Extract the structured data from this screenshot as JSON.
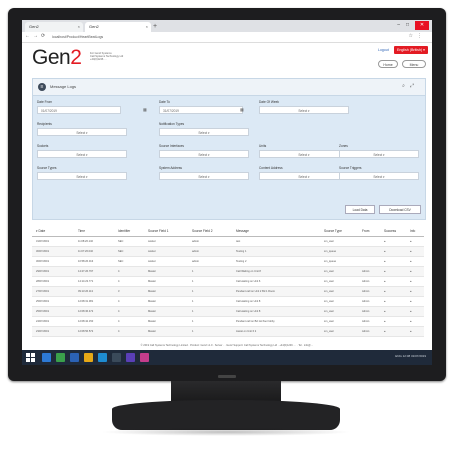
{
  "browser": {
    "tabs": [
      "Gen2",
      "Gen2"
    ],
    "url": "localhost/Product/HeartBeatLogs",
    "window_controls": [
      "–",
      "□",
      "✕"
    ]
  },
  "app": {
    "logo_main": "Gen",
    "logo_accent": "2",
    "tagline_lines": [
      "For Gen2 Systems",
      "Call Systems Technology Ltd",
      "+44(0)1246 …"
    ],
    "login_label": "Logout",
    "language_button": "English (British) ▾",
    "buttons": [
      "Home",
      "Menu"
    ]
  },
  "panel": {
    "title": "Message Logs",
    "filters": [
      {
        "label": "Date From",
        "value": "01/07/2019"
      },
      {
        "label": "Date To",
        "value": "31/07/2019"
      },
      {
        "label": "Date Of Week",
        "value": "Select ▾"
      },
      {
        "label": "Recipients",
        "value": "Select ▾"
      },
      {
        "label": "Notification Types",
        "value": "Select ▾"
      },
      {
        "label": "Sockets",
        "value": "Select ▾"
      },
      {
        "label": "Source Interfaces",
        "value": "Select ▾"
      },
      {
        "label": "Units",
        "value": "Select ▾"
      },
      {
        "label": "Zones",
        "value": "Select ▾"
      },
      {
        "label": "Source Types",
        "value": "Select ▾"
      },
      {
        "label": "System Address",
        "value": "Select ▾"
      },
      {
        "label": "Content Address",
        "value": "Select ▾"
      },
      {
        "label": "Source Triggers",
        "value": "Select ▾"
      }
    ],
    "buttons": [
      "Load Data",
      "Download CSV"
    ]
  },
  "table": {
    "columns": [
      "▾ Date",
      "Time",
      "Identifier",
      "Source Field 1",
      "Source Field 2",
      "Message",
      "Source Type",
      "From",
      "Success",
      "Info"
    ],
    "rows": [
      [
        "31/07/2019",
        "11:08:26.132",
        "SEC",
        "worker",
        "admin",
        "test",
        "sm_user",
        "",
        "●",
        "●"
      ],
      [
        "30/07/2019",
        "11:07:26.032",
        "SEC",
        "worker",
        "admin",
        "Testing 1",
        "sm_queue",
        "",
        "●",
        "●"
      ],
      [
        "30/07/2019",
        "10:58:26.013",
        "SEC",
        "worker",
        "admin",
        "Testing 2",
        "sm_queue",
        "",
        "●",
        "●"
      ],
      [
        "29/07/2019",
        "14:27:26.797",
        "4",
        "Master",
        "1",
        "Call Waiting on Unit 8",
        "sm_user",
        "Admin",
        "●",
        "●"
      ],
      [
        "28/07/2019",
        "14:14:23.771",
        "4",
        "Master",
        "1",
        "Call waiting on Unit 6",
        "sm_user",
        "Admin",
        "●",
        "●"
      ],
      [
        "27/07/2019",
        "09:13:26.113",
        "3",
        "Master",
        "1",
        "Pendant call on Unit 2 Bd 1 Room",
        "sm_user",
        "Admin",
        "●",
        "●"
      ],
      [
        "25/07/2019",
        "12:08:31.381",
        "4",
        "Master",
        "1",
        "Call waiting on Unit 8",
        "sm_user",
        "Admin",
        "●",
        "●"
      ],
      [
        "25/07/2019",
        "12:08:36.472",
        "4",
        "Master",
        "1",
        "Call waiting on Unit 8",
        "sm_user",
        "Admin",
        "●",
        "●"
      ],
      [
        "24/07/2019",
        "12:08:42.150",
        "4",
        "Master",
        "1",
        "Pendant call on Bd 1st floor lobby",
        "sm_user",
        "Admin",
        "●",
        "●"
      ],
      [
        "23/07/2019",
        "12:08:56.572",
        "4",
        "Master",
        "1",
        "Assist on Unit 6 2",
        "sm_user",
        "Admin",
        "●",
        "●"
      ]
    ]
  },
  "footer": "© 2019 Call Systems Technology Limited · Product: Gen2 v1.0 · Server · · Gen2 Support: Call Systems Technology Ltd · +44(0)1246 … · Tel · info@…",
  "taskbar": {
    "tray_text": "ENG  12:08  31/07/2019",
    "icon_colors": [
      "#2d7ad6",
      "#3aa04b",
      "#2b62b5",
      "#e6a817",
      "#1e8cd1",
      "#3a4a5a",
      "#5a3fb6",
      "#c43d8c"
    ]
  }
}
